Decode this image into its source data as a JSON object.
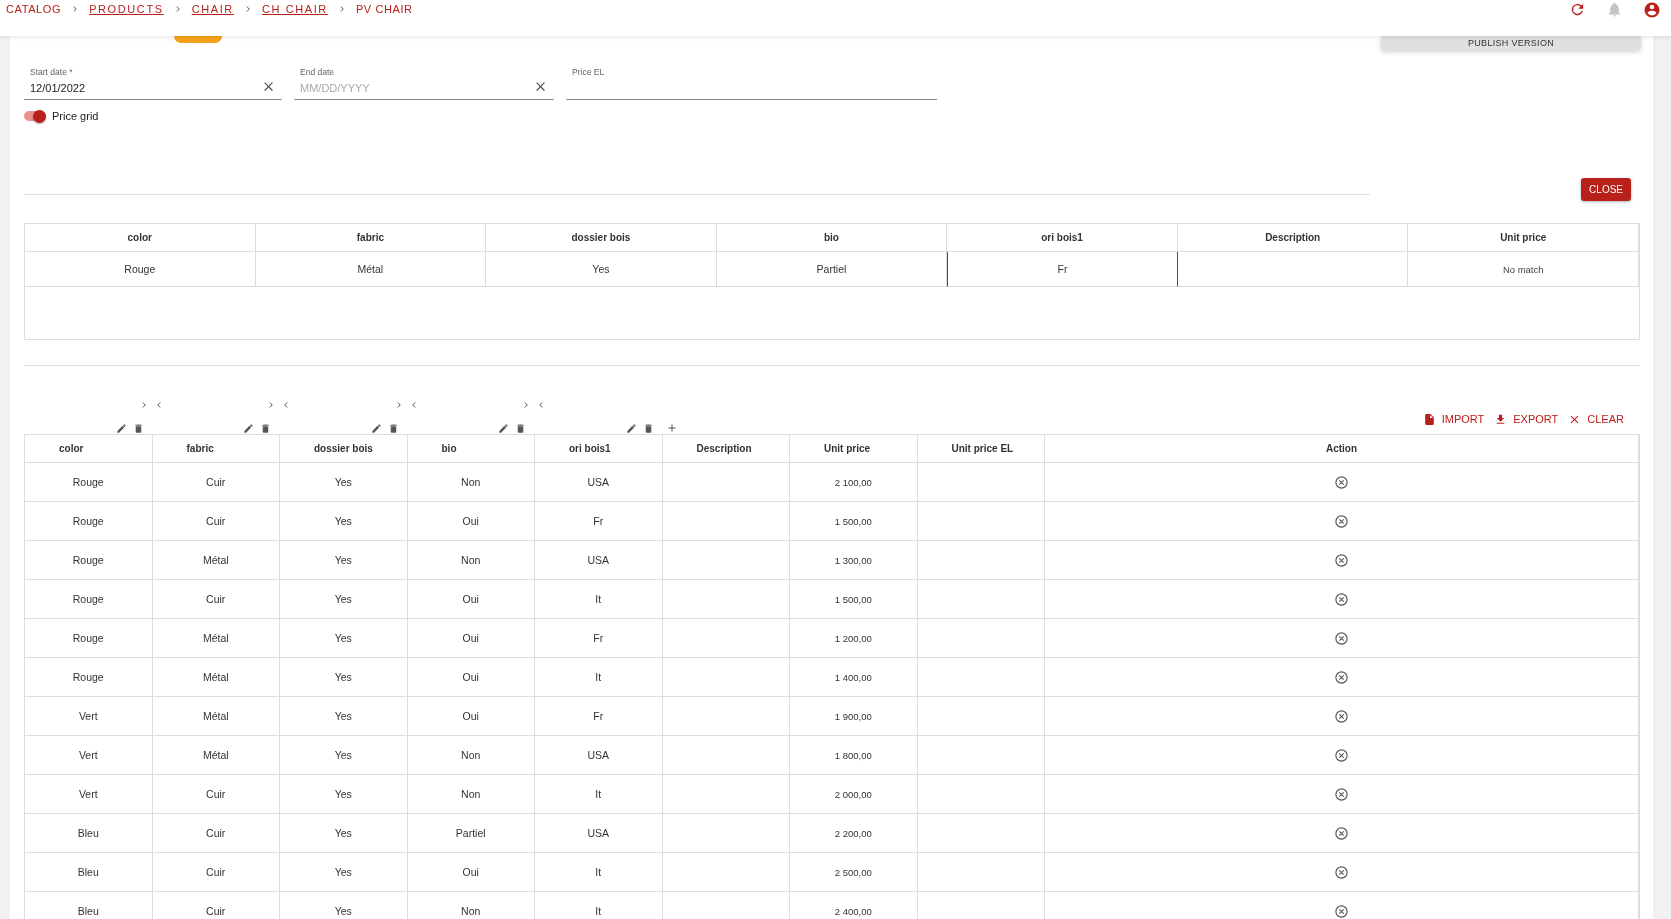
{
  "breadcrumb": [
    {
      "label": "CATALOG",
      "link": false
    },
    {
      "label": "PRODUCTS",
      "link": true
    },
    {
      "label": "CHAIR",
      "link": true
    },
    {
      "label": "CH CHAIR",
      "link": true
    },
    {
      "label": "PV CHAIR",
      "link": false
    }
  ],
  "publish_button": "PUBLISH VERSION",
  "form": {
    "fields": [
      {
        "label": "Start date *",
        "value": "12/01/2022",
        "clearable": true
      },
      {
        "label": "End date",
        "placeholder": "MM/DD/YYYY",
        "clearable": true
      },
      {
        "label": "Price EL",
        "clearable": false
      }
    ],
    "price_grid": {
      "label": "Price grid",
      "on": true
    }
  },
  "close_button": "CLOSE",
  "match_table": {
    "columns": [
      "color",
      "fabric",
      "dossier bois",
      "bio",
      "ori bois1",
      "Description",
      "Unit price"
    ],
    "rows": [
      {
        "cells": [
          {
            "text": "Rouge",
            "highlighted": false
          },
          {
            "text": "Métal",
            "highlighted": false
          },
          {
            "text": "Yes",
            "highlighted": false
          },
          {
            "text": "Partiel",
            "highlighted": false
          },
          {
            "text": "Fr",
            "highlighted": true
          },
          {
            "highlighted": false
          },
          {
            "text": "No match",
            "highlighted": false
          }
        ]
      }
    ]
  },
  "price_table": {
    "actions": [
      {
        "kind": "import",
        "label": "IMPORT"
      },
      {
        "kind": "export",
        "label": "EXPORT"
      },
      {
        "kind": "clear",
        "label": "CLEAR"
      }
    ],
    "columns": [
      {
        "label": "color",
        "kind": "text",
        "tools": true,
        "add_column": false
      },
      {
        "label": "fabric",
        "kind": "text",
        "tools": true,
        "add_column": false
      },
      {
        "label": "dossier bois",
        "kind": "text",
        "tools": true,
        "add_column": false
      },
      {
        "label": "bio",
        "kind": "text",
        "tools": true,
        "add_column": false
      },
      {
        "label": "ori bois1",
        "kind": "text",
        "tools": true,
        "add_column": false
      },
      {
        "label": "Description",
        "kind": "blank",
        "tools": false,
        "add_column": true
      },
      {
        "label": "Unit price",
        "kind": "price",
        "tools": false,
        "add_column": false
      },
      {
        "label": "Unit price EL",
        "kind": "blank",
        "tools": false,
        "add_column": false
      },
      {
        "label": "Action",
        "kind": "action",
        "tools": false,
        "add_column": false
      }
    ],
    "rows": [
      {
        "cells": [
          "Rouge",
          "Cuir",
          "Yes",
          "Non",
          "USA"
        ],
        "unit_price": "2 100,00"
      },
      {
        "cells": [
          "Rouge",
          "Cuir",
          "Yes",
          "Oui",
          "Fr"
        ],
        "unit_price": "1 500,00"
      },
      {
        "cells": [
          "Rouge",
          "Métal",
          "Yes",
          "Non",
          "USA"
        ],
        "unit_price": "1 300,00"
      },
      {
        "cells": [
          "Rouge",
          "Cuir",
          "Yes",
          "Oui",
          "It"
        ],
        "unit_price": "1 500,00"
      },
      {
        "cells": [
          "Rouge",
          "Métal",
          "Yes",
          "Oui",
          "Fr"
        ],
        "unit_price": "1 200,00"
      },
      {
        "cells": [
          "Rouge",
          "Métal",
          "Yes",
          "Oui",
          "It"
        ],
        "unit_price": "1 400,00"
      },
      {
        "cells": [
          "Vert",
          "Métal",
          "Yes",
          "Oui",
          "Fr"
        ],
        "unit_price": "1 900,00"
      },
      {
        "cells": [
          "Vert",
          "Métal",
          "Yes",
          "Non",
          "USA"
        ],
        "unit_price": "1 800,00"
      },
      {
        "cells": [
          "Vert",
          "Cuir",
          "Yes",
          "Non",
          "It"
        ],
        "unit_price": "2 000,00"
      },
      {
        "cells": [
          "Bleu",
          "Cuir",
          "Yes",
          "Partiel",
          "USA"
        ],
        "unit_price": "2 200,00"
      },
      {
        "cells": [
          "Bleu",
          "Cuir",
          "Yes",
          "Oui",
          "It"
        ],
        "unit_price": "2 500,00"
      },
      {
        "cells": [
          "Bleu",
          "Cuir",
          "Yes",
          "Non",
          "It"
        ],
        "unit_price": "2 400,00"
      }
    ]
  }
}
